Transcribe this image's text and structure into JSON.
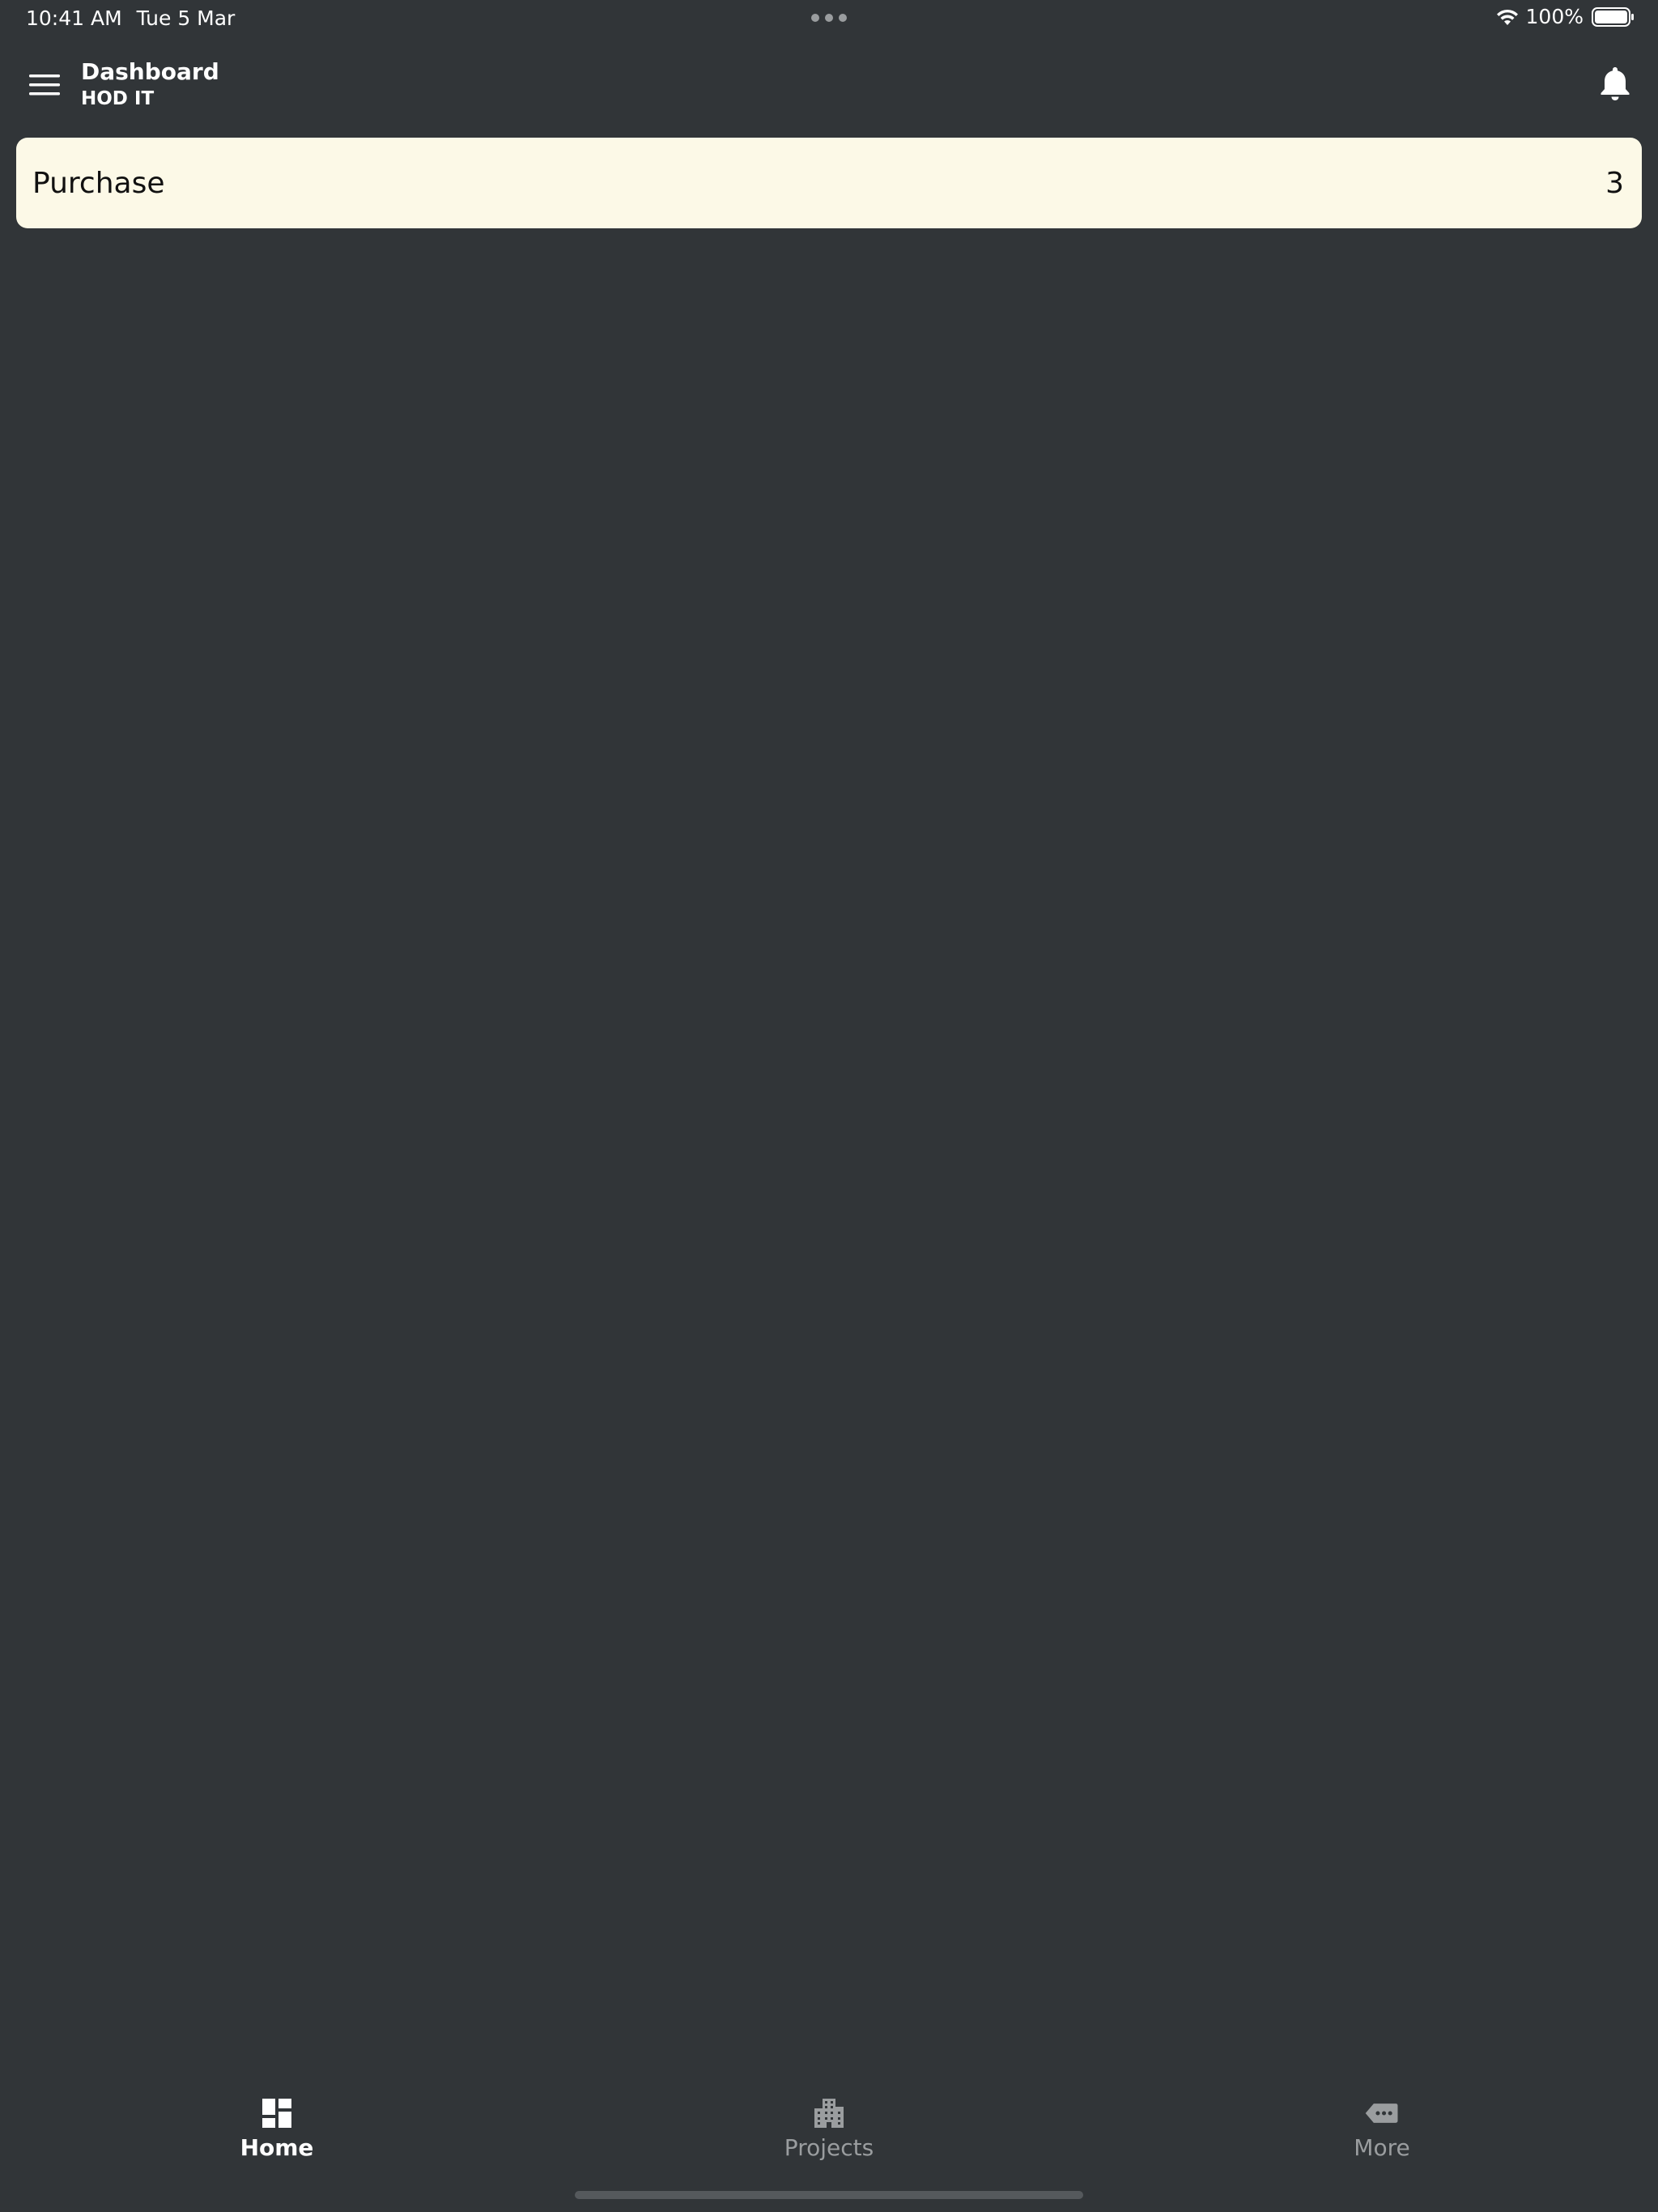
{
  "status_bar": {
    "time": "10:41 AM",
    "date": "Tue 5 Mar",
    "battery": "100%"
  },
  "header": {
    "title": "Dashboard",
    "subtitle": "HOD IT",
    "menu_icon": "hamburger-menu-icon",
    "notification_icon": "bell-icon"
  },
  "cards": [
    {
      "label": "Purchase",
      "count": "3"
    }
  ],
  "tabs": [
    {
      "label": "Home",
      "icon": "dashboard-icon",
      "active": true
    },
    {
      "label": "Projects",
      "icon": "building-icon",
      "active": false
    },
    {
      "label": "More",
      "icon": "more-tag-icon",
      "active": false
    }
  ],
  "colors": {
    "background": "#313538",
    "card_background": "#fcf9e7",
    "active_tab": "#ffffff",
    "inactive_tab": "#9a9d9f"
  }
}
